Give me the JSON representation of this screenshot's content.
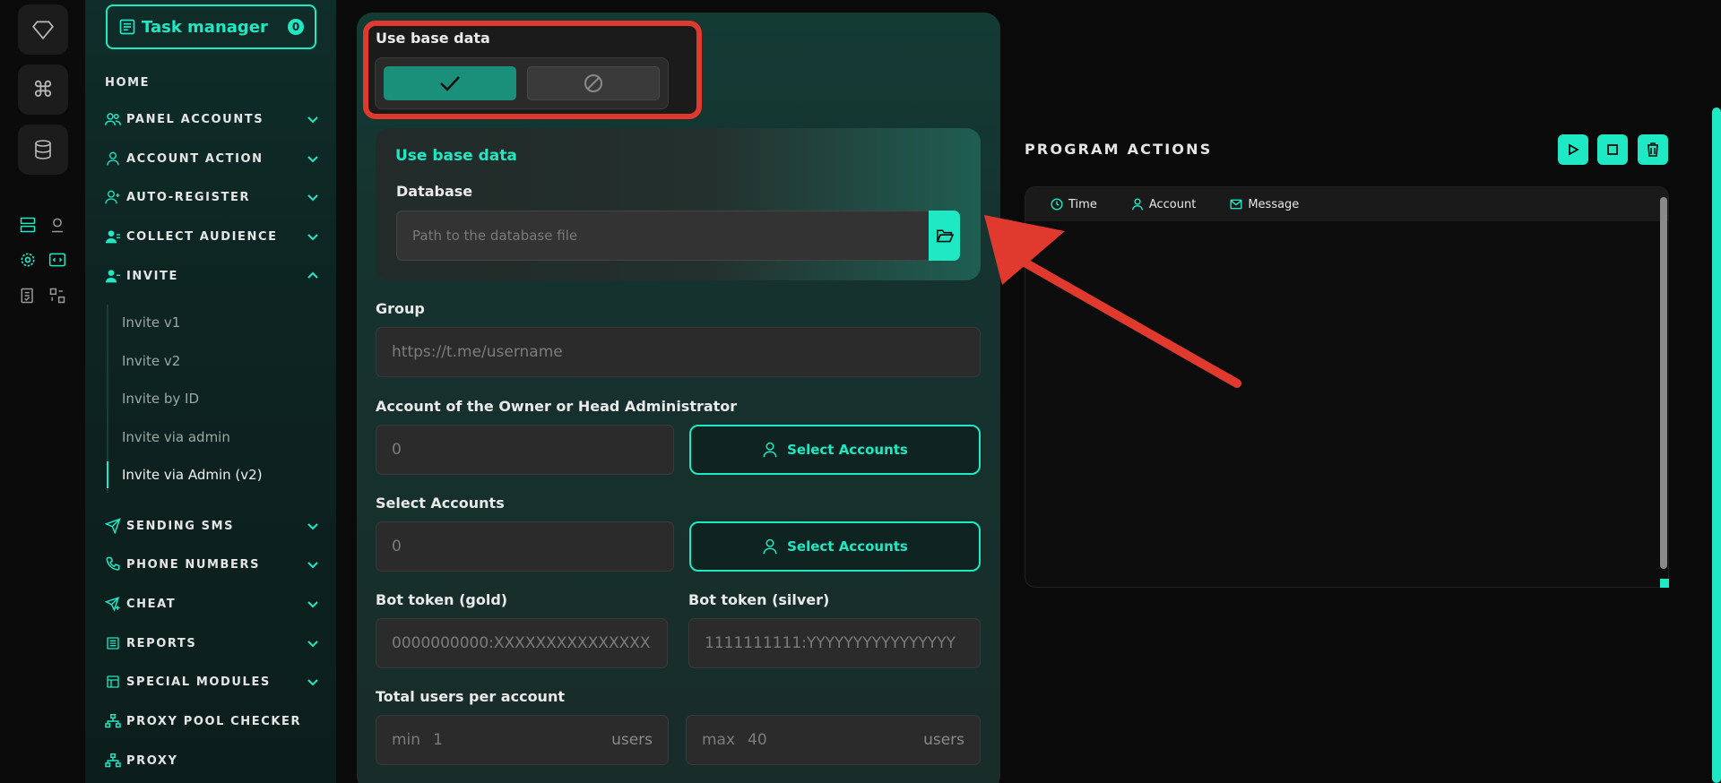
{
  "task_manager": {
    "label": "Task manager",
    "count": "0"
  },
  "sidebar": {
    "items": [
      {
        "label": "HOME"
      },
      {
        "label": "PANEL ACCOUNTS"
      },
      {
        "label": "ACCOUNT ACTION"
      },
      {
        "label": "AUTO-REGISTER"
      },
      {
        "label": "COLLECT AUDIENCE"
      },
      {
        "label": "INVITE"
      },
      {
        "label": "SENDING SMS"
      },
      {
        "label": "PHONE NUMBERS"
      },
      {
        "label": "CHEAT"
      },
      {
        "label": "REPORTS"
      },
      {
        "label": "SPECIAL MODULES"
      },
      {
        "label": "PROXY POOL CHECKER"
      },
      {
        "label": "PROXY"
      }
    ],
    "invite_sub": [
      "Invite v1",
      "Invite v2",
      "Invite by ID",
      "Invite via admin",
      "Invite via Admin (v2)"
    ]
  },
  "form": {
    "use_base_data_label": "Use base data",
    "db_card_title": "Use base data",
    "database_label": "Database",
    "database_placeholder": "Path to the database file",
    "group_label": "Group",
    "group_placeholder": "https://t.me/username",
    "owner_label": "Account of the Owner or Head Administrator",
    "owner_value": "0",
    "select_accounts_btn": "Select Accounts",
    "select_accounts_label": "Select Accounts",
    "select_accounts_value": "0",
    "bot_gold_label": "Bot token (gold)",
    "bot_gold_placeholder": "0000000000:XXXXXXXXXXXXXXX",
    "bot_silver_label": "Bot token (silver)",
    "bot_silver_placeholder": "1111111111:YYYYYYYYYYYYYYYY",
    "total_users_label": "Total users per account",
    "min_prefix": "min",
    "min_value": "1",
    "max_prefix": "max",
    "max_value": "40",
    "users_unit": "users"
  },
  "program_actions": {
    "title": "PROGRAM ACTIONS",
    "columns": [
      "Time",
      "Account",
      "Message"
    ]
  },
  "colors": {
    "accent": "#1fe8c4",
    "highlight": "#e03a2f"
  }
}
